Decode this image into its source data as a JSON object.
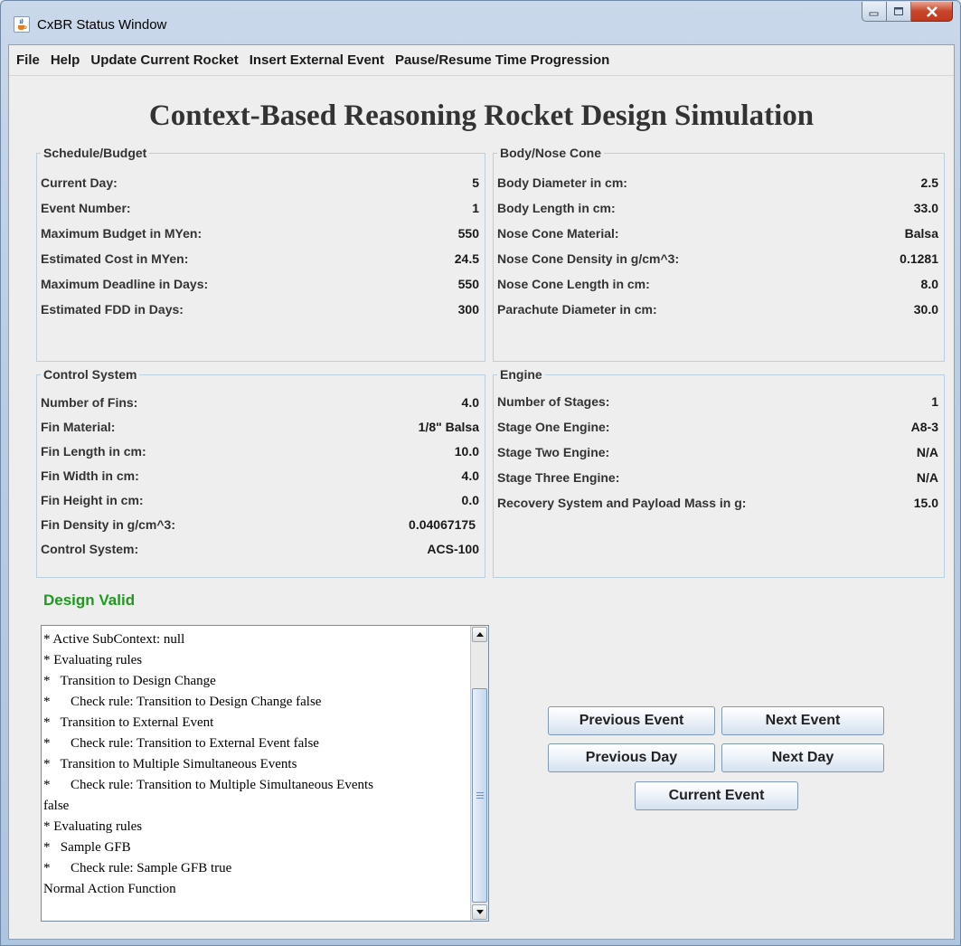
{
  "window": {
    "title": "CxBR Status Window"
  },
  "menu": [
    "File",
    "Help",
    "Update Current Rocket",
    "Insert External Event",
    "Pause/Resume Time Progression"
  ],
  "main_title": "Context-Based Reasoning Rocket Design Simulation",
  "schedule_budget": {
    "legend": "Schedule/Budget",
    "rows": [
      {
        "label": "Current Day:",
        "value": "5"
      },
      {
        "label": "Event Number:",
        "value": "1"
      },
      {
        "label": "Maximum Budget in MYen:",
        "value": "550"
      },
      {
        "label": "Estimated Cost in MYen:",
        "value": "24.5"
      },
      {
        "label": "Maximum Deadline in Days:",
        "value": "550"
      },
      {
        "label": "Estimated FDD in Days:",
        "value": "300"
      }
    ]
  },
  "body_nose_cone": {
    "legend": "Body/Nose Cone",
    "rows": [
      {
        "label": "Body Diameter in cm:",
        "value": "2.5"
      },
      {
        "label": "Body Length in cm:",
        "value": "33.0"
      },
      {
        "label": "Nose Cone Material:",
        "value": "Balsa"
      },
      {
        "label": "Nose Cone Density in g/cm^3:",
        "value": "0.1281"
      },
      {
        "label": "Nose Cone Length in cm:",
        "value": "8.0"
      },
      {
        "label": "Parachute Diameter in cm:",
        "value": "30.0"
      }
    ]
  },
  "control_system": {
    "legend": "Control System",
    "rows": [
      {
        "label": "Number of Fins:",
        "value": "4.0"
      },
      {
        "label": "Fin Material:",
        "value": "1/8\" Balsa"
      },
      {
        "label": "Fin Length in cm:",
        "value": "10.0"
      },
      {
        "label": "Fin Width in cm:",
        "value": "4.0"
      },
      {
        "label": "Fin Height in cm:",
        "value": "0.0"
      },
      {
        "label": "Fin Density in g/cm^3:",
        "value": "0.04067175"
      },
      {
        "label": "Control System:",
        "value": "ACS-100"
      }
    ]
  },
  "engine": {
    "legend": "Engine",
    "rows": [
      {
        "label": "Number of Stages:",
        "value": "1"
      },
      {
        "label": "Stage One Engine:",
        "value": "A8-3"
      },
      {
        "label": "Stage Two Engine:",
        "value": "N/A"
      },
      {
        "label": "Stage Three Engine:",
        "value": "N/A"
      },
      {
        "label": "Recovery System and Payload Mass in g:",
        "value": "15.0"
      }
    ]
  },
  "design_status": "Design Valid",
  "log_lines": [
    "* Active SubContext: null",
    "* Evaluating rules",
    "*   Transition to Design Change",
    "*      Check rule: Transition to Design Change false",
    "*   Transition to External Event",
    "*      Check rule: Transition to External Event false",
    "*   Transition to Multiple Simultaneous Events",
    "*      Check rule: Transition to Multiple Simultaneous Events",
    "false",
    "* Evaluating rules",
    "*   Sample GFB",
    "*      Check rule: Sample GFB true",
    "Normal Action Function"
  ],
  "buttons": {
    "previous_event": "Previous Event",
    "next_event": "Next Event",
    "previous_day": "Previous Day",
    "next_day": "Next Day",
    "current_event": "Current Event"
  },
  "colors": {
    "design_valid": "#1e9a1e",
    "panel_border": "#b8cfe0",
    "button_border": "#7f98b6"
  },
  "icons": {
    "app": "java-coffee-cup-icon",
    "minimize": "minimize-icon",
    "maximize": "maximize-icon",
    "close": "close-icon",
    "scroll_up": "arrow-up-icon",
    "scroll_down": "arrow-down-icon"
  }
}
